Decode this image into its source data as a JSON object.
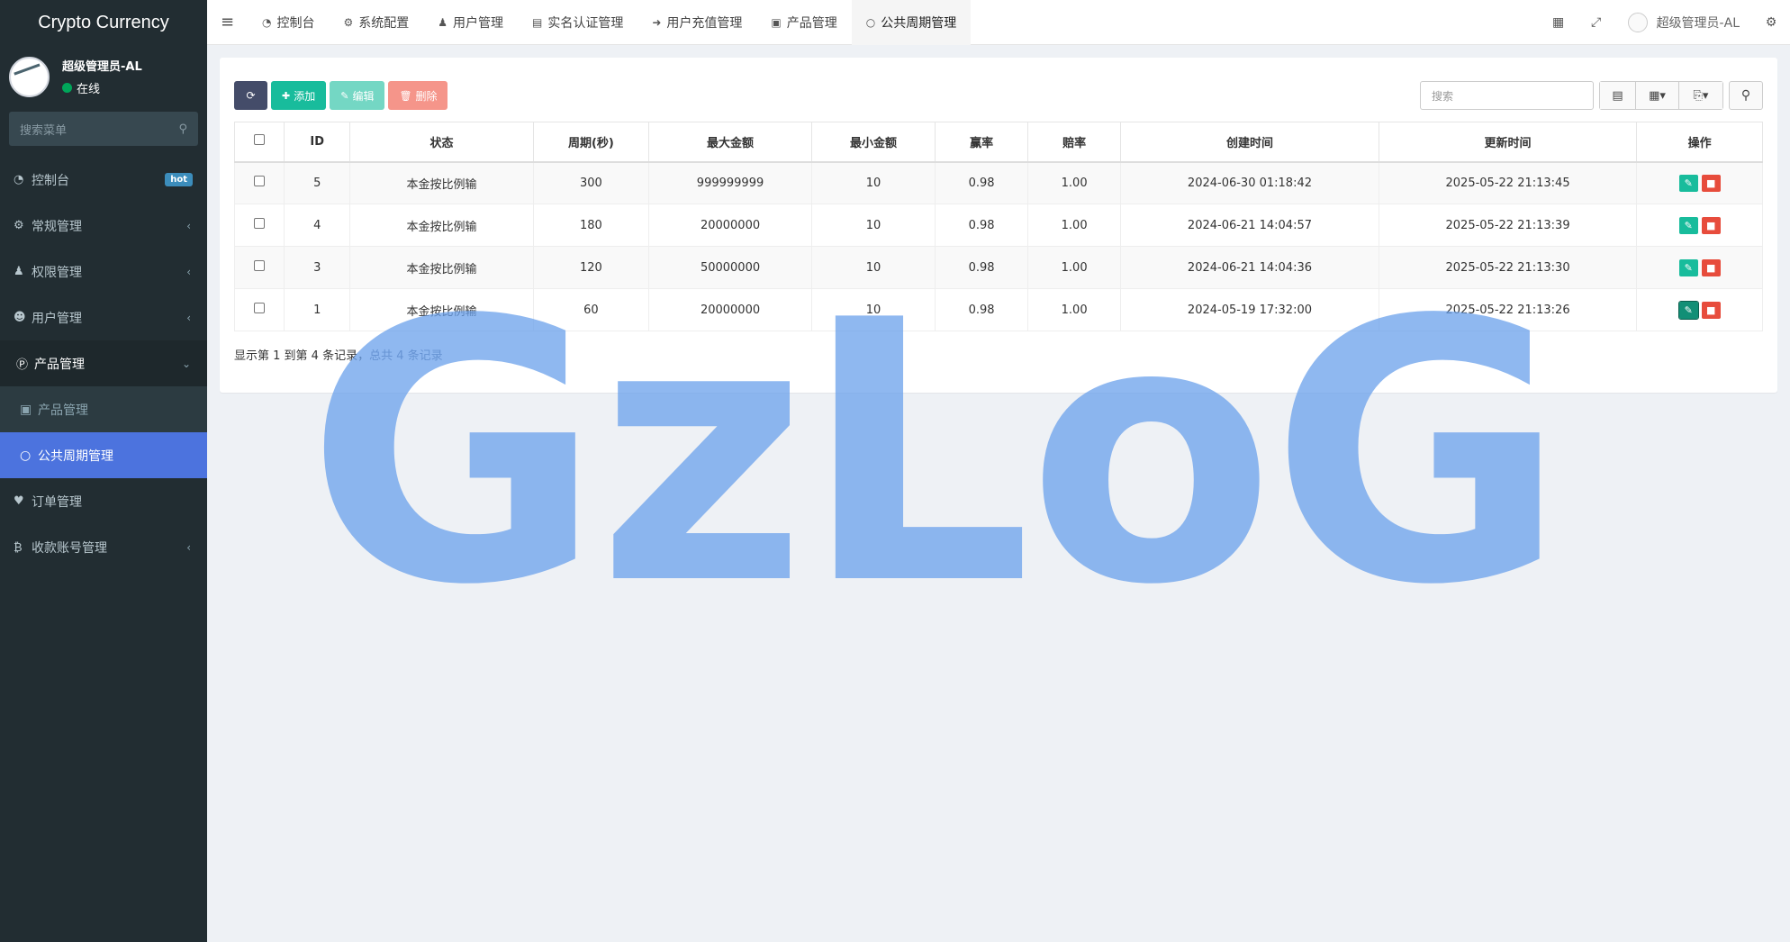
{
  "sidebar": {
    "brand": "Crypto Currency",
    "user_name": "超级管理员-AL",
    "user_status": "在线",
    "search_placeholder": "搜索菜单",
    "menu": [
      {
        "label": "控制台",
        "icon": "dashboard-icon",
        "badge": "hot"
      },
      {
        "label": "常规管理",
        "icon": "cogs-icon"
      },
      {
        "label": "权限管理",
        "icon": "group-icon"
      },
      {
        "label": "用户管理",
        "icon": "user-circle-icon"
      },
      {
        "label": "产品管理",
        "icon": "product-icon"
      }
    ],
    "submenu": [
      {
        "label": "产品管理",
        "icon": "shopping-bag-icon"
      },
      {
        "label": "公共周期管理",
        "icon": "circle-icon"
      }
    ],
    "menu_after": [
      {
        "label": "订单管理",
        "icon": "heartbeat-icon"
      },
      {
        "label": "收款账号管理",
        "icon": "bitcoin-icon"
      }
    ]
  },
  "topnav": {
    "tabs": [
      {
        "label": "控制台"
      },
      {
        "label": "系统配置"
      },
      {
        "label": "用户管理"
      },
      {
        "label": "实名认证管理"
      },
      {
        "label": "用户充值管理"
      },
      {
        "label": "产品管理"
      },
      {
        "label": "公共周期管理"
      }
    ],
    "user": "超级管理员-AL"
  },
  "toolbar": {
    "add": "添加",
    "edit": "编辑",
    "delete": "删除",
    "search_placeholder": "搜索"
  },
  "table": {
    "headers": [
      "ID",
      "状态",
      "周期(秒)",
      "最大金额",
      "最小金额",
      "赢率",
      "赔率",
      "创建时间",
      "更新时间",
      "操作"
    ],
    "rows": [
      [
        "5",
        "本金按比例输",
        "300",
        "999999999",
        "10",
        "0.98",
        "1.00",
        "2024-06-30 01:18:42",
        "2025-05-22 21:13:45"
      ],
      [
        "4",
        "本金按比例输",
        "180",
        "20000000",
        "10",
        "0.98",
        "1.00",
        "2024-06-21 14:04:57",
        "2025-05-22 21:13:39"
      ],
      [
        "3",
        "本金按比例输",
        "120",
        "50000000",
        "10",
        "0.98",
        "1.00",
        "2024-06-21 14:04:36",
        "2025-05-22 21:13:30"
      ],
      [
        "1",
        "本金按比例输",
        "60",
        "20000000",
        "10",
        "0.98",
        "1.00",
        "2024-05-19 17:32:00",
        "2025-05-22 21:13:26"
      ]
    ]
  },
  "pager": {
    "text": "显示第 1 到第 4 条记录，",
    "total": "总共 4 条记录"
  },
  "watermark": "GzLoG"
}
